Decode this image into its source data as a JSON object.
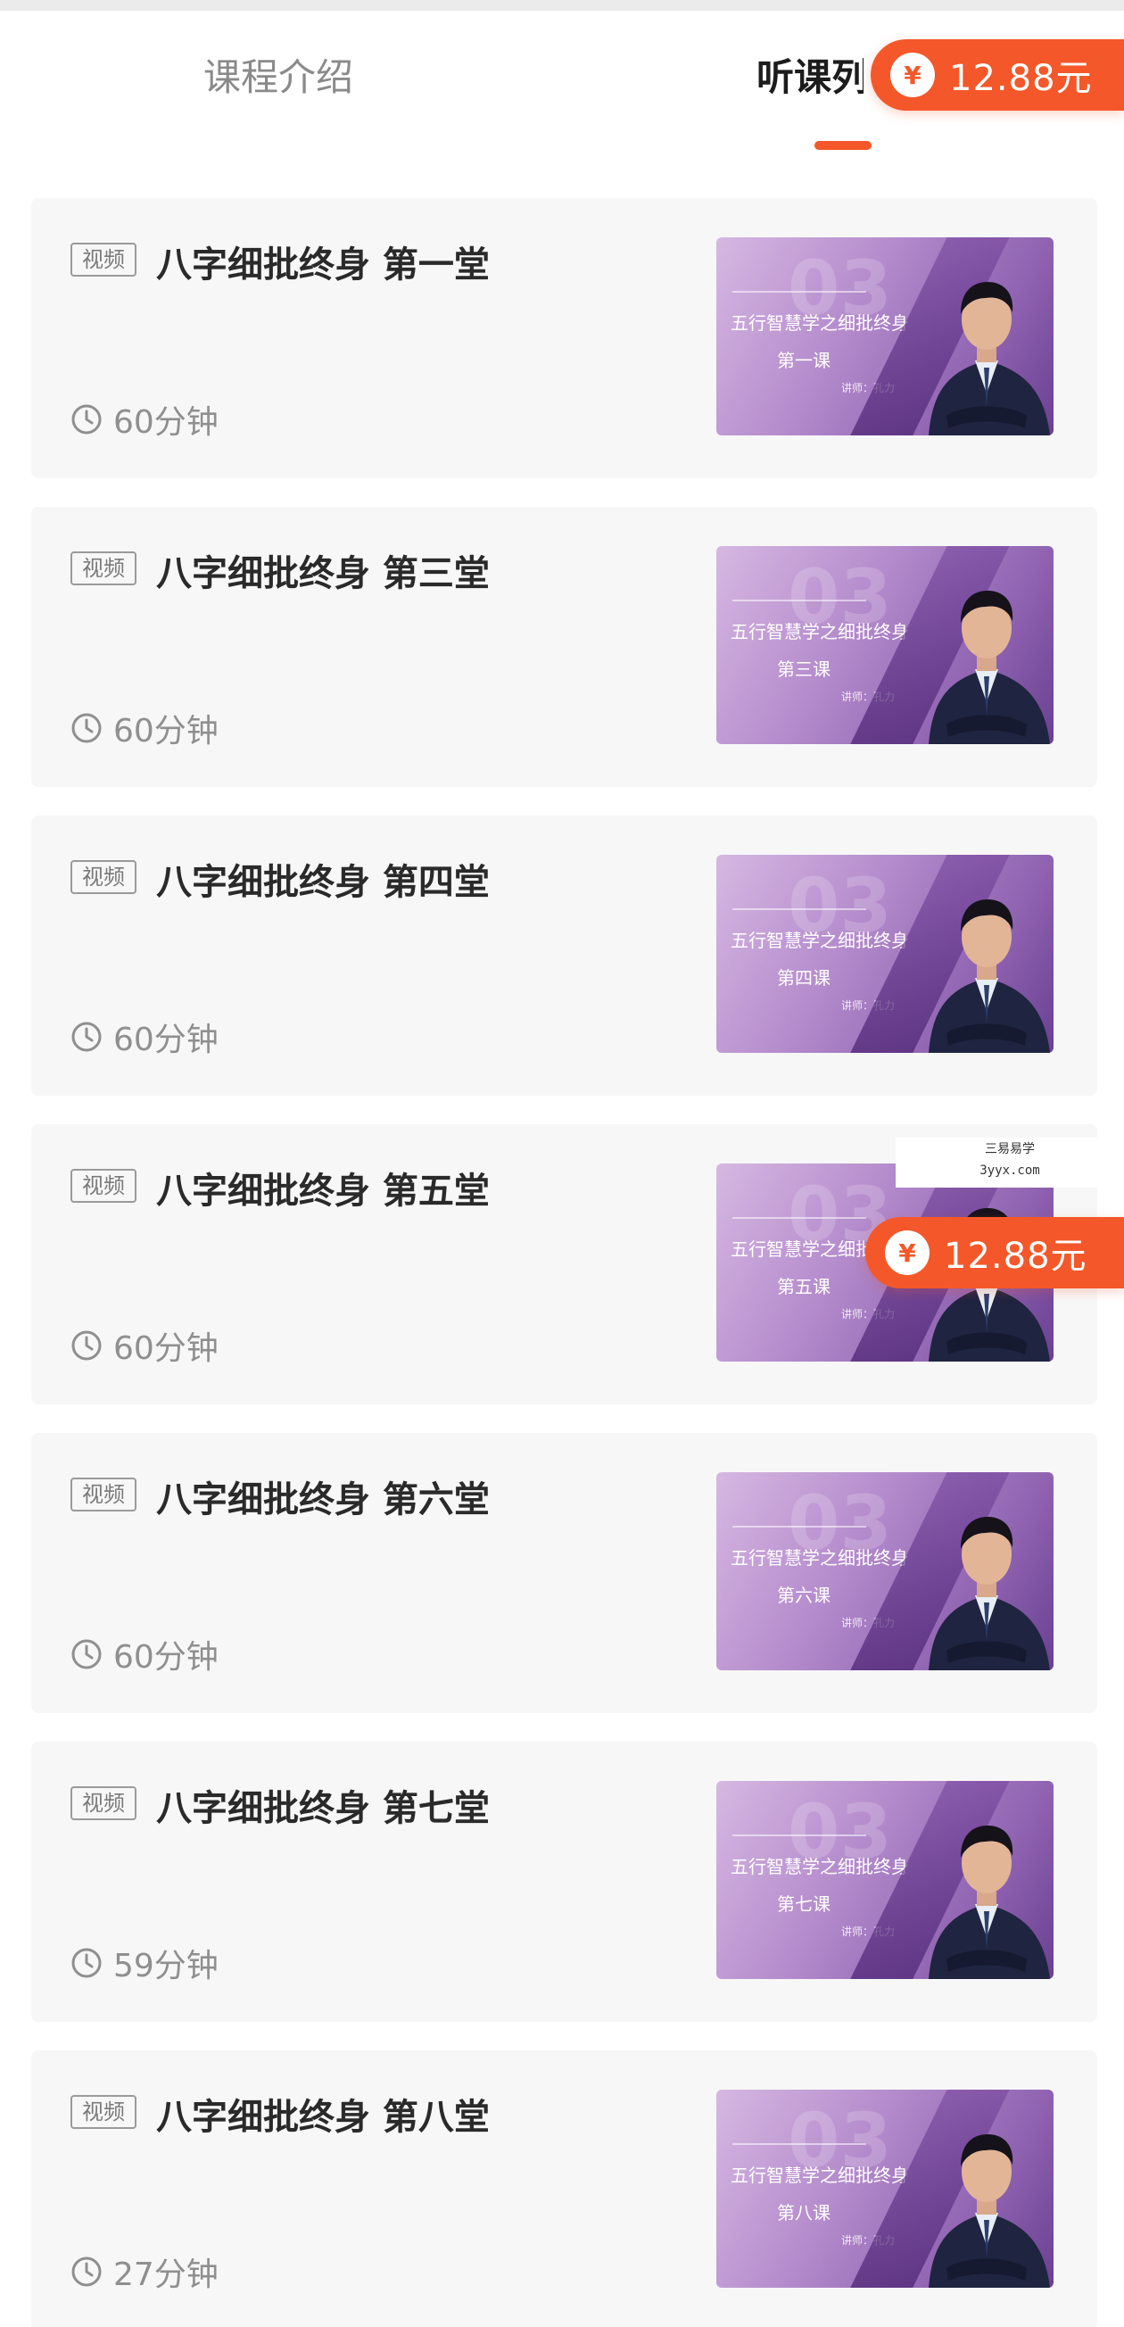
{
  "tabs": {
    "intro": "课程介绍",
    "list": "听课列表",
    "active": "list"
  },
  "price_pill": {
    "icon": "money-bag-icon",
    "icon_glyph": "¥",
    "price": "12.88元"
  },
  "watermark": {
    "cn": "三易易学",
    "url": "3yyx.com"
  },
  "lesson_tag": "视频",
  "lessons": [
    {
      "title": "八字细批终身 第一堂",
      "duration": "60分钟",
      "thumb_subtitle": "五行智慧学之细批终身",
      "thumb_lesson": "第一课",
      "thumb_teacher": "讲师：孔力"
    },
    {
      "title": "八字细批终身 第三堂",
      "duration": "60分钟",
      "thumb_subtitle": "五行智慧学之细批终身",
      "thumb_lesson": "第三课",
      "thumb_teacher": "讲师：孔力"
    },
    {
      "title": "八字细批终身 第四堂",
      "duration": "60分钟",
      "thumb_subtitle": "五行智慧学之细批终身",
      "thumb_lesson": "第四课",
      "thumb_teacher": "讲师：孔力"
    },
    {
      "title": "八字细批终身 第五堂",
      "duration": "60分钟",
      "thumb_subtitle": "五行智慧学之细批终身",
      "thumb_lesson": "第五课",
      "thumb_teacher": "讲师：孔力"
    },
    {
      "title": "八字细批终身 第六堂",
      "duration": "60分钟",
      "thumb_subtitle": "五行智慧学之细批终身",
      "thumb_lesson": "第六课",
      "thumb_teacher": "讲师：孔力"
    },
    {
      "title": "八字细批终身 第七堂",
      "duration": "59分钟",
      "thumb_subtitle": "五行智慧学之细批终身",
      "thumb_lesson": "第七课",
      "thumb_teacher": "讲师：孔力"
    },
    {
      "title": "八字细批终身 第八堂",
      "duration": "27分钟",
      "thumb_subtitle": "五行智慧学之细批终身",
      "thumb_lesson": "第八课",
      "thumb_teacher": "讲师：孔力"
    }
  ],
  "thumb_number": "03",
  "colors": {
    "accent": "#f4582a",
    "card_bg": "#f7f7f7",
    "thumb_purple": "#9b6fc0"
  }
}
